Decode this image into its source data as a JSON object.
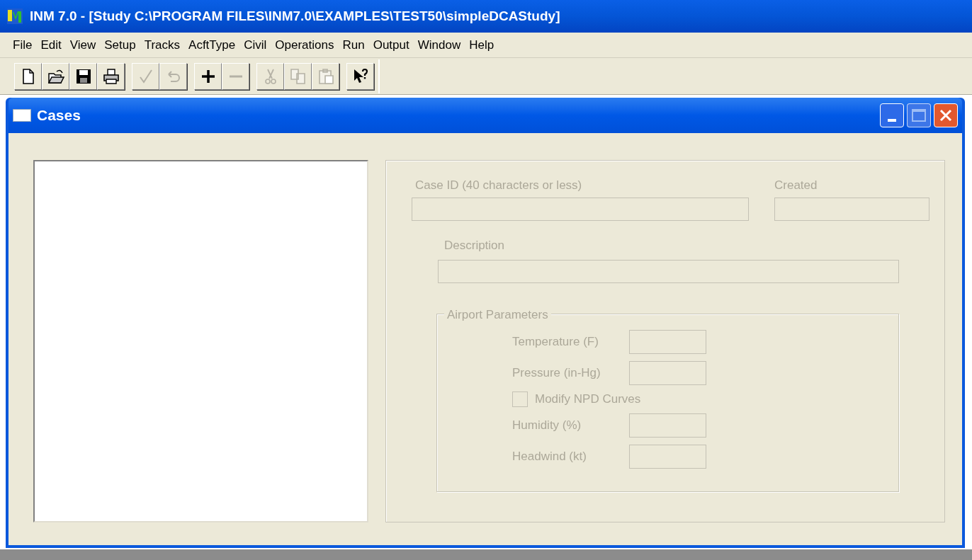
{
  "app_window": {
    "title": "INM 7.0  - [Study C:\\PROGRAM FILES\\INM7.0\\EXAMPLES\\TEST50\\simpleDCAStudy]"
  },
  "menu": [
    "File",
    "Edit",
    "View",
    "Setup",
    "Tracks",
    "AcftType",
    "Civil",
    "Operations",
    "Run",
    "Output",
    "Window",
    "Help"
  ],
  "toolbar": [
    [
      {
        "kind": "new",
        "disabled": false
      },
      {
        "kind": "open",
        "disabled": false
      },
      {
        "kind": "save",
        "disabled": false
      },
      {
        "kind": "print",
        "disabled": false
      }
    ],
    [
      {
        "kind": "check",
        "disabled": true
      },
      {
        "kind": "undo",
        "disabled": true
      }
    ],
    [
      {
        "kind": "plus",
        "disabled": false
      },
      {
        "kind": "minus",
        "disabled": true
      }
    ],
    [
      {
        "kind": "cut",
        "disabled": true
      },
      {
        "kind": "copy",
        "disabled": true
      },
      {
        "kind": "paste",
        "disabled": true
      }
    ],
    [
      {
        "kind": "help",
        "disabled": false
      }
    ]
  ],
  "child_window": {
    "title": "Cases"
  },
  "form": {
    "case_id": {
      "label": "Case ID (40 characters or less)",
      "disabled": true
    },
    "created": {
      "label": "Created",
      "disabled": true
    },
    "description": {
      "label": "Description",
      "disabled": true
    },
    "airport_parameters": {
      "legend": "Airport Parameters",
      "rows": [
        {
          "kind": "field",
          "label": "Temperature (F)",
          "disabled": true
        },
        {
          "kind": "field",
          "label": "Pressure (in-Hg)",
          "disabled": true
        },
        {
          "kind": "checkbox",
          "label": "Modify NPD Curves",
          "checked": false,
          "disabled": true
        },
        {
          "kind": "field",
          "label": "Humidity (%)",
          "disabled": true
        },
        {
          "kind": "field",
          "label": "Headwind (kt)",
          "disabled": true
        }
      ]
    }
  }
}
